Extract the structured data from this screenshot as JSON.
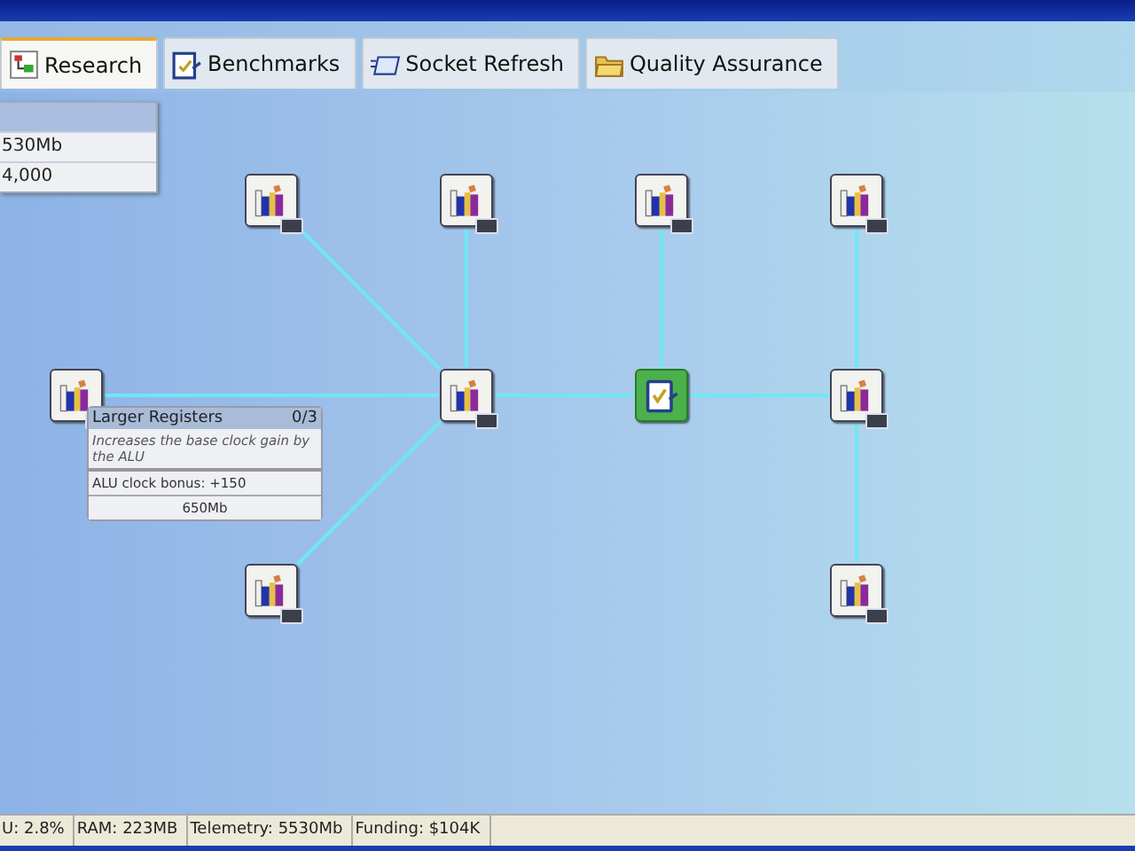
{
  "tabs": [
    {
      "label": "Research",
      "selected": true
    },
    {
      "label": "Benchmarks",
      "selected": false
    },
    {
      "label": "Socket Refresh",
      "selected": false
    },
    {
      "label": "Quality Assurance",
      "selected": false
    }
  ],
  "info_panel": {
    "rows": [
      "530Mb",
      "4,000"
    ]
  },
  "nodes": [
    {
      "kind": "research",
      "selected": false
    },
    {
      "kind": "research",
      "selected": false
    },
    {
      "kind": "research",
      "selected": false
    },
    {
      "kind": "research",
      "selected": false
    },
    {
      "kind": "research",
      "selected": false
    },
    {
      "kind": "research",
      "selected": false
    },
    {
      "kind": "benchmark",
      "selected": true
    },
    {
      "kind": "research",
      "selected": false
    },
    {
      "kind": "research",
      "selected": false
    },
    {
      "kind": "research",
      "selected": false
    }
  ],
  "tooltip": {
    "title": "Larger Registers",
    "rank": "0/3",
    "description": "Increases the base clock gain by the ALU",
    "effect": "ALU clock bonus:  +150",
    "cost": "650Mb"
  },
  "status_bar": [
    "U: 2.8%",
    "RAM: 223MB",
    "Telemetry: 5530Mb",
    "Funding: $104K"
  ]
}
